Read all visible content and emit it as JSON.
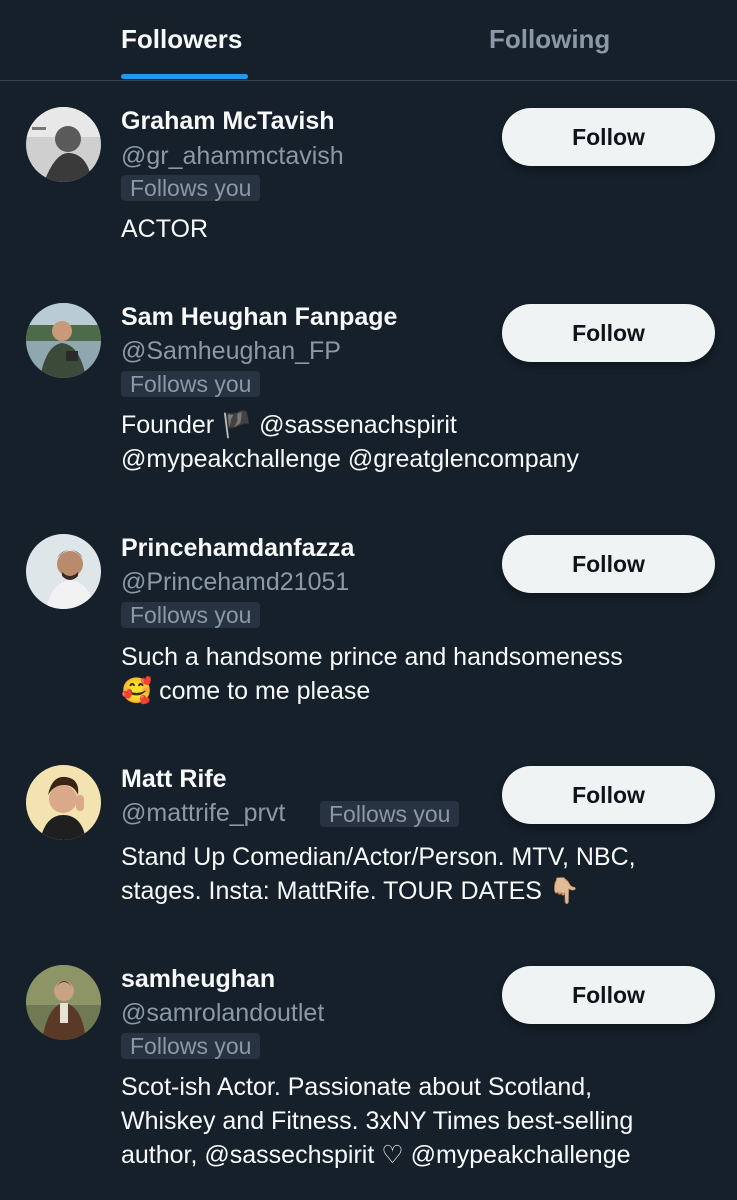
{
  "tabs": {
    "followers": "Followers",
    "following": "Following"
  },
  "follow_label": "Follow",
  "follows_you_label": "Follows you",
  "users": [
    {
      "name": "Graham McTavish",
      "handle": "@gr_ahammctavish",
      "bio": [
        "ACTOR"
      ]
    },
    {
      "name": "Sam Heughan Fanpage",
      "handle": "@Samheughan_FP",
      "bio": [
        "Founder 🏴 @sassenachspirit",
        "@mypeakchallenge @greatglencompany"
      ]
    },
    {
      "name": "Princehamdanfazza",
      "handle": "@Princehamd21051",
      "bio": [
        "Such a handsome prince and handsomeness",
        "🥰 come to me please"
      ]
    },
    {
      "name": "Matt Rife",
      "handle": "@mattrife_prvt",
      "bio": [
        "Stand Up Comedian/Actor/Person. MTV, NBC,",
        "stages. Insta: MattRife. TOUR DATES 👇🏼"
      ]
    },
    {
      "name": "samheughan",
      "handle": "@samrolandoutlet",
      "bio": [
        "Scot-ish Actor. Passionate about Scotland,",
        "Whiskey and Fitness. 3xNY Times best-selling",
        "author, @sassechspirit ♡ @mypeakchallenge"
      ]
    }
  ],
  "colors": {
    "background": "#15202b",
    "accent": "#1d9bf0",
    "secondary_text": "#8b98a5",
    "button_bg": "#eff3f4"
  }
}
